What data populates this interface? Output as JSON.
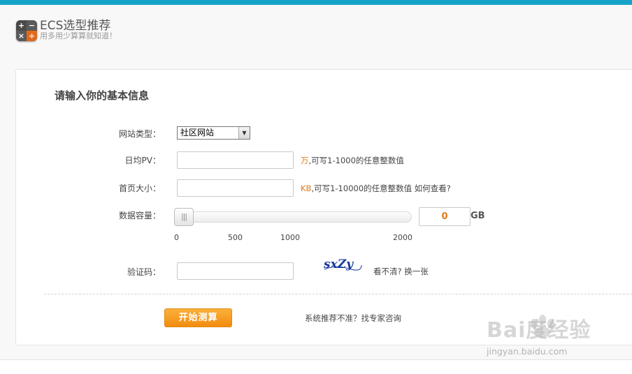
{
  "header": {
    "title": "ECS选型推荐",
    "subtitle": "用多用少算算就知道！",
    "icon_glyphs": [
      "+",
      "−",
      "×",
      "÷"
    ]
  },
  "form": {
    "section_title": "请输入你的基本信息",
    "site_type": {
      "label": "网站类型：",
      "selected": "社区网站",
      "arrow": "▼"
    },
    "daily_pv": {
      "label": "日均PV：",
      "value": "",
      "unit": "万",
      "hint": ",可写1-1000的任意整数值"
    },
    "homepage_size": {
      "label": "首页大小：",
      "value": "",
      "unit": "KB",
      "hint": ",可写1-10000的任意整数值 如何查看?"
    },
    "data_capacity": {
      "label": "数据容量：",
      "value": "0",
      "unit": "GB",
      "slider_level": 0,
      "slider_max": 2000,
      "ticks": [
        "0",
        "500",
        "1000",
        "2000"
      ]
    },
    "captcha": {
      "label": "验证码：",
      "value": "",
      "image_text": "sxZy",
      "refresh_text": "看不清? 换一张"
    }
  },
  "actions": {
    "start_label": "开始测算",
    "consult_text": "系统推荐不准？找专家咨询"
  },
  "watermark": {
    "text": "Bai度经验",
    "url": "jingyan.baidu.com"
  },
  "colors": {
    "accent_top": "#16a2c8",
    "orange": "#f28c0f",
    "unit_orange": "#e07b17"
  }
}
